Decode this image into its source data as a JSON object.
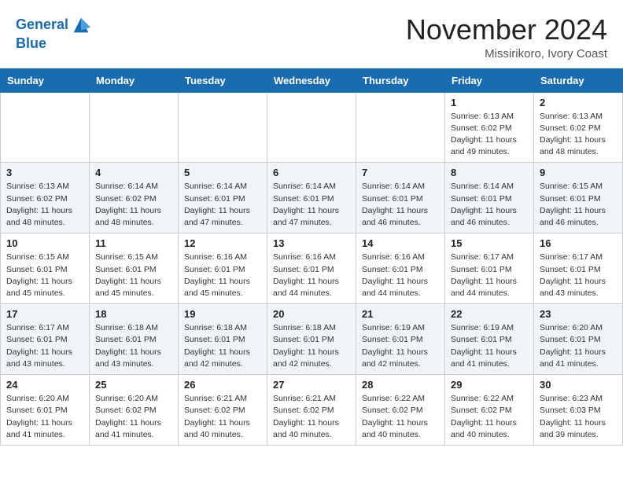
{
  "header": {
    "logo_line1": "General",
    "logo_line2": "Blue",
    "month_title": "November 2024",
    "location": "Missirikoro, Ivory Coast"
  },
  "weekdays": [
    "Sunday",
    "Monday",
    "Tuesday",
    "Wednesday",
    "Thursday",
    "Friday",
    "Saturday"
  ],
  "weeks": [
    [
      {
        "day": "",
        "sunrise": "",
        "sunset": "",
        "daylight": ""
      },
      {
        "day": "",
        "sunrise": "",
        "sunset": "",
        "daylight": ""
      },
      {
        "day": "",
        "sunrise": "",
        "sunset": "",
        "daylight": ""
      },
      {
        "day": "",
        "sunrise": "",
        "sunset": "",
        "daylight": ""
      },
      {
        "day": "",
        "sunrise": "",
        "sunset": "",
        "daylight": ""
      },
      {
        "day": "1",
        "sunrise": "Sunrise: 6:13 AM",
        "sunset": "Sunset: 6:02 PM",
        "daylight": "Daylight: 11 hours and 49 minutes."
      },
      {
        "day": "2",
        "sunrise": "Sunrise: 6:13 AM",
        "sunset": "Sunset: 6:02 PM",
        "daylight": "Daylight: 11 hours and 48 minutes."
      }
    ],
    [
      {
        "day": "3",
        "sunrise": "Sunrise: 6:13 AM",
        "sunset": "Sunset: 6:02 PM",
        "daylight": "Daylight: 11 hours and 48 minutes."
      },
      {
        "day": "4",
        "sunrise": "Sunrise: 6:14 AM",
        "sunset": "Sunset: 6:02 PM",
        "daylight": "Daylight: 11 hours and 48 minutes."
      },
      {
        "day": "5",
        "sunrise": "Sunrise: 6:14 AM",
        "sunset": "Sunset: 6:01 PM",
        "daylight": "Daylight: 11 hours and 47 minutes."
      },
      {
        "day": "6",
        "sunrise": "Sunrise: 6:14 AM",
        "sunset": "Sunset: 6:01 PM",
        "daylight": "Daylight: 11 hours and 47 minutes."
      },
      {
        "day": "7",
        "sunrise": "Sunrise: 6:14 AM",
        "sunset": "Sunset: 6:01 PM",
        "daylight": "Daylight: 11 hours and 46 minutes."
      },
      {
        "day": "8",
        "sunrise": "Sunrise: 6:14 AM",
        "sunset": "Sunset: 6:01 PM",
        "daylight": "Daylight: 11 hours and 46 minutes."
      },
      {
        "day": "9",
        "sunrise": "Sunrise: 6:15 AM",
        "sunset": "Sunset: 6:01 PM",
        "daylight": "Daylight: 11 hours and 46 minutes."
      }
    ],
    [
      {
        "day": "10",
        "sunrise": "Sunrise: 6:15 AM",
        "sunset": "Sunset: 6:01 PM",
        "daylight": "Daylight: 11 hours and 45 minutes."
      },
      {
        "day": "11",
        "sunrise": "Sunrise: 6:15 AM",
        "sunset": "Sunset: 6:01 PM",
        "daylight": "Daylight: 11 hours and 45 minutes."
      },
      {
        "day": "12",
        "sunrise": "Sunrise: 6:16 AM",
        "sunset": "Sunset: 6:01 PM",
        "daylight": "Daylight: 11 hours and 45 minutes."
      },
      {
        "day": "13",
        "sunrise": "Sunrise: 6:16 AM",
        "sunset": "Sunset: 6:01 PM",
        "daylight": "Daylight: 11 hours and 44 minutes."
      },
      {
        "day": "14",
        "sunrise": "Sunrise: 6:16 AM",
        "sunset": "Sunset: 6:01 PM",
        "daylight": "Daylight: 11 hours and 44 minutes."
      },
      {
        "day": "15",
        "sunrise": "Sunrise: 6:17 AM",
        "sunset": "Sunset: 6:01 PM",
        "daylight": "Daylight: 11 hours and 44 minutes."
      },
      {
        "day": "16",
        "sunrise": "Sunrise: 6:17 AM",
        "sunset": "Sunset: 6:01 PM",
        "daylight": "Daylight: 11 hours and 43 minutes."
      }
    ],
    [
      {
        "day": "17",
        "sunrise": "Sunrise: 6:17 AM",
        "sunset": "Sunset: 6:01 PM",
        "daylight": "Daylight: 11 hours and 43 minutes."
      },
      {
        "day": "18",
        "sunrise": "Sunrise: 6:18 AM",
        "sunset": "Sunset: 6:01 PM",
        "daylight": "Daylight: 11 hours and 43 minutes."
      },
      {
        "day": "19",
        "sunrise": "Sunrise: 6:18 AM",
        "sunset": "Sunset: 6:01 PM",
        "daylight": "Daylight: 11 hours and 42 minutes."
      },
      {
        "day": "20",
        "sunrise": "Sunrise: 6:18 AM",
        "sunset": "Sunset: 6:01 PM",
        "daylight": "Daylight: 11 hours and 42 minutes."
      },
      {
        "day": "21",
        "sunrise": "Sunrise: 6:19 AM",
        "sunset": "Sunset: 6:01 PM",
        "daylight": "Daylight: 11 hours and 42 minutes."
      },
      {
        "day": "22",
        "sunrise": "Sunrise: 6:19 AM",
        "sunset": "Sunset: 6:01 PM",
        "daylight": "Daylight: 11 hours and 41 minutes."
      },
      {
        "day": "23",
        "sunrise": "Sunrise: 6:20 AM",
        "sunset": "Sunset: 6:01 PM",
        "daylight": "Daylight: 11 hours and 41 minutes."
      }
    ],
    [
      {
        "day": "24",
        "sunrise": "Sunrise: 6:20 AM",
        "sunset": "Sunset: 6:01 PM",
        "daylight": "Daylight: 11 hours and 41 minutes."
      },
      {
        "day": "25",
        "sunrise": "Sunrise: 6:20 AM",
        "sunset": "Sunset: 6:02 PM",
        "daylight": "Daylight: 11 hours and 41 minutes."
      },
      {
        "day": "26",
        "sunrise": "Sunrise: 6:21 AM",
        "sunset": "Sunset: 6:02 PM",
        "daylight": "Daylight: 11 hours and 40 minutes."
      },
      {
        "day": "27",
        "sunrise": "Sunrise: 6:21 AM",
        "sunset": "Sunset: 6:02 PM",
        "daylight": "Daylight: 11 hours and 40 minutes."
      },
      {
        "day": "28",
        "sunrise": "Sunrise: 6:22 AM",
        "sunset": "Sunset: 6:02 PM",
        "daylight": "Daylight: 11 hours and 40 minutes."
      },
      {
        "day": "29",
        "sunrise": "Sunrise: 6:22 AM",
        "sunset": "Sunset: 6:02 PM",
        "daylight": "Daylight: 11 hours and 40 minutes."
      },
      {
        "day": "30",
        "sunrise": "Sunrise: 6:23 AM",
        "sunset": "Sunset: 6:03 PM",
        "daylight": "Daylight: 11 hours and 39 minutes."
      }
    ]
  ]
}
